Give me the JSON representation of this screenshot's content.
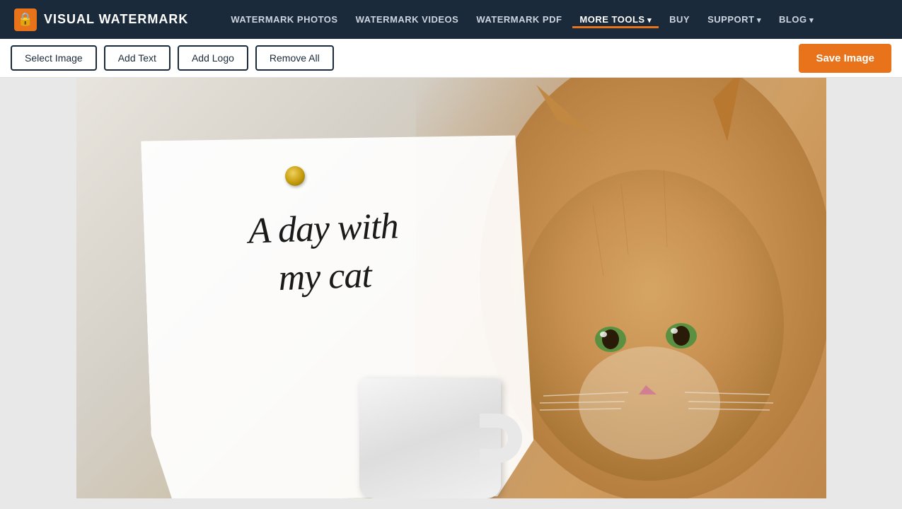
{
  "brand": {
    "logo_symbol": "🔒",
    "name": "VISUAL WATERMARK"
  },
  "navbar": {
    "links": [
      {
        "label": "WATERMARK PHOTOS",
        "active": false,
        "has_arrow": false
      },
      {
        "label": "WATERMARK VIDEOS",
        "active": false,
        "has_arrow": false
      },
      {
        "label": "WATERMARK PDF",
        "active": false,
        "has_arrow": false
      },
      {
        "label": "MORE TOOLS",
        "active": true,
        "has_arrow": true
      },
      {
        "label": "BUY",
        "active": false,
        "has_arrow": false
      },
      {
        "label": "SUPPORT",
        "active": false,
        "has_arrow": true
      },
      {
        "label": "BLOG",
        "active": false,
        "has_arrow": true
      }
    ]
  },
  "toolbar": {
    "select_image_label": "Select Image",
    "add_text_label": "Add Text",
    "add_logo_label": "Add Logo",
    "remove_all_label": "Remove All",
    "save_image_label": "Save Image"
  },
  "canvas": {
    "note_line1": "A day with",
    "note_line2": "my cat"
  }
}
